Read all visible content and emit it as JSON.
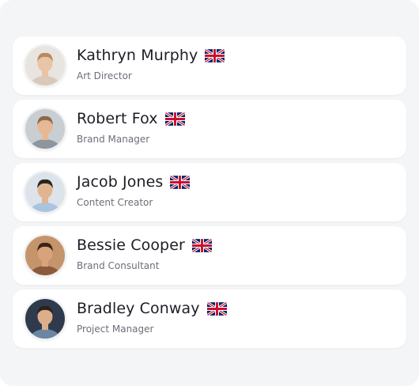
{
  "people": [
    {
      "name": "Kathryn Murphy",
      "role": "Art Director",
      "flag": "uk-flag-icon",
      "avatar": {
        "bg": "#e8e4df",
        "skin": "#e9c4a6",
        "hair": "#b88a5e",
        "shirt": "#d9c9b8"
      }
    },
    {
      "name": "Robert Fox",
      "role": "Brand Manager",
      "flag": "uk-flag-icon",
      "avatar": {
        "bg": "#c9ced3",
        "skin": "#e7b896",
        "hair": "#8a6a4a",
        "shirt": "#8d969c"
      }
    },
    {
      "name": "Jacob Jones",
      "role": "Content Creator",
      "flag": "uk-flag-icon",
      "avatar": {
        "bg": "#dde3ea",
        "skin": "#e2b592",
        "hair": "#2a2420",
        "shirt": "#a9c4df"
      }
    },
    {
      "name": "Bessie Cooper",
      "role": "Brand Consultant",
      "flag": "uk-flag-icon",
      "avatar": {
        "bg": "#c4956b",
        "skin": "#d7a27c",
        "hair": "#3b2418",
        "shirt": "#8c5a3a"
      }
    },
    {
      "name": "Bradley Conway",
      "role": "Project Manager",
      "flag": "uk-flag-icon",
      "avatar": {
        "bg": "#2f3b4c",
        "skin": "#dcae8c",
        "hair": "#2b211b",
        "shirt": "#6b86a3"
      }
    }
  ],
  "colors": {
    "card": "#ffffff",
    "background": "#f4f5f7",
    "name": "#1d1d25",
    "role": "#6b6f78"
  }
}
